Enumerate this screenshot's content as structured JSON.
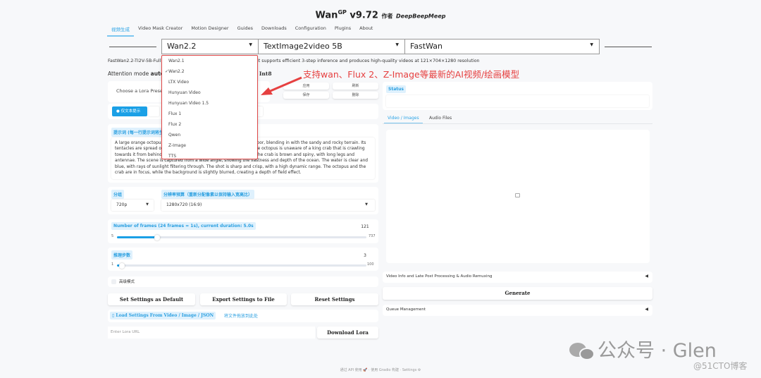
{
  "header": {
    "app": "Wan",
    "sup": "GP",
    "version": "v9.72",
    "by": "作者",
    "author": "DeepBeepMeep"
  },
  "tabs": [
    "视频生成",
    "Video Mask Creator",
    "Motion Designer",
    "Guides",
    "Downloads",
    "Configuration",
    "Plugins",
    "About"
  ],
  "model": {
    "family": "Wan2.2",
    "type": "TextImage2video 5B",
    "variant": "FastWan"
  },
  "model_dropdown": {
    "options": [
      "Wan2.1",
      "Wan2.2",
      "LTX Video",
      "Hunyuan Video",
      "Hunyuan Video 1.5",
      "Flux 1",
      "Flux 2",
      "Qwen",
      "Z-Image",
      "TTS"
    ],
    "checkmark": "✓"
  },
  "description": {
    "left": "FastWan2.2-TI2V-5B-Full",
    "right": "B-Diffusers. It supports efficient 3-step inference and produces high-quality videos at 121×704×1280 resolution"
  },
  "attention": {
    "left_label": "Attention mode",
    "left_value": "auto/",
    "right": "aled Int8"
  },
  "annotation": "支持wan、Flux 2、Z-Image等最新的AI视频/绘画模型",
  "lora": {
    "preset_placeholder": "Choose a Lora Preset",
    "buttons": [
      "应用",
      "刷新",
      "保存",
      "删除"
    ],
    "url_placeholder": "Enter Lora URL",
    "download": "Download Lora"
  },
  "prompt_mode": {
    "selected": "仅文本提示",
    "other_partial": "图"
  },
  "prompt": {
    "label": "提示词 (每一行提示词将生",
    "text": "A large orange octopus is seen resting on the bottom of the ocean floor, blending in with the sandy and rocky terrain. Its tentacles are spread out around its body, and its eyes are closed. The octopus is unaware of a king crab that is crawling towards it from behind a rock, its claws raised and ready to attack. The crab is brown and spiny, with long legs and antennae. The scene is captured from a wide angle, showing the vastness and depth of the ocean. The water is clear and blue, with rays of sunlight filtering through. The shot is sharp and crisp, with a high dynamic range. The octopus and the crab are in focus, while the background is slightly blurred, creating a depth of field effect."
  },
  "resolution": {
    "group_label": "分组",
    "group_value": "720p",
    "res_label": "分辨率预算（重新分配像素以保持输入宽高比）",
    "res_value": "1280x720 (16:9)"
  },
  "frames": {
    "label": "Number of frames (24 frames = 1s), current duration: 5.0s",
    "value": "121",
    "min": "5",
    "max": "737",
    "fraction": 0.16
  },
  "steps": {
    "label": "推理步数",
    "value": "3",
    "min": "1",
    "max": "100",
    "fraction": 0.02
  },
  "advanced": "高级模式",
  "settings_buttons": [
    "Set Settings as Default",
    "Export Settings to File",
    "Reset Settings"
  ],
  "load_settings": {
    "label": "Load Settings From Video / Image / JSON",
    "drop": "将文件拖放到此处"
  },
  "status": {
    "label": "Status"
  },
  "output_tabs": [
    "Video / Images",
    "Audio Files"
  ],
  "video_info": "Video Info and Late Post Processing & Audio Remuxing",
  "generate": "Generate",
  "queue": "Queue Management",
  "footer": {
    "api": "通过 API 使用",
    "gradio": "使用 Gradio 构建",
    "settings": "Settings"
  },
  "watermark": {
    "main": "公众号 · Glen",
    "sub": "@51CTO博客"
  }
}
